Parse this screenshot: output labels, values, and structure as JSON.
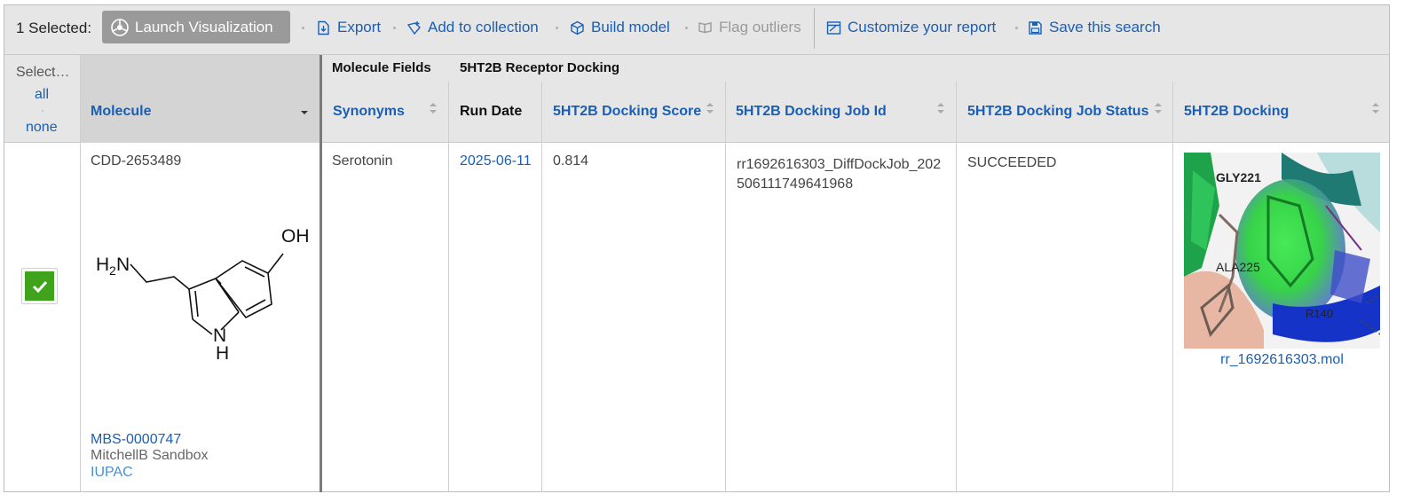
{
  "toolbar": {
    "selected_label": "1 Selected:",
    "launch_label": "Launch Visualization",
    "actions": [
      {
        "label": "Export",
        "icon": "export-icon",
        "enabled": true
      },
      {
        "label": "Add to collection",
        "icon": "add-to-collection-icon",
        "enabled": true
      },
      {
        "label": "Build model",
        "icon": "cube-icon",
        "enabled": true
      },
      {
        "label": "Flag outliers",
        "icon": "flag-icon",
        "enabled": false
      },
      {
        "label": "Customize your report",
        "icon": "customize-report-icon",
        "enabled": true
      },
      {
        "label": "Save this search",
        "icon": "save-icon",
        "enabled": true
      }
    ]
  },
  "header": {
    "select_label": "Select…",
    "select_all": "all",
    "select_sep": "·",
    "select_none": "none",
    "molecule_col": "Molecule",
    "group_molecule_fields": "Molecule Fields",
    "group_docking": "5HT2B Receptor Docking",
    "columns": {
      "synonyms": "Synonyms",
      "run_date": "Run Date",
      "docking_score": "5HT2B Docking Score",
      "job_id": "5HT2B Docking Job Id",
      "job_status": "5HT2B Docking Job Status",
      "docking": "5HT2B Docking"
    }
  },
  "row": {
    "checked": true,
    "molecule_id": "CDD-2653489",
    "structure": {
      "atom_oh": "OH",
      "atom_h2n_h": "H",
      "atom_h2n_sub": "2",
      "atom_h2n_n": "N",
      "atom_nh_n": "N",
      "atom_nh_h": "H"
    },
    "batch_id": "MBS-0000747",
    "project": "MitchellB Sandbox",
    "iupac": "IUPAC",
    "synonyms": "Serotonin",
    "run_date": "2025-06-11",
    "docking_score": "0.814",
    "job_id_line1": "rr1692616303_DiffDockJob_202",
    "job_id_line2": "506111749641968",
    "job_status": "SUCCEEDED",
    "docking_file": "rr_1692616303.mol",
    "residues": {
      "r1": "GLY221",
      "r2": "ALA225",
      "r3": "R140"
    }
  },
  "colors": {
    "link": "#1a5fb4",
    "toolbar_bg": "#e6e6e6",
    "checkbox_green": "#3fa31c"
  }
}
